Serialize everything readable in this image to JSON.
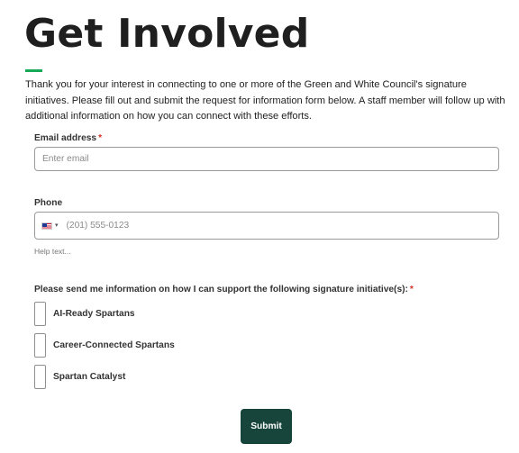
{
  "page": {
    "title": "Get Involved",
    "intro": "Thank you for your interest in connecting to one or more of the Green and White Council's signature initiatives. Please fill out and submit the request for information form below. A staff member will follow up with additional information on how you can connect with these efforts.",
    "accent_color": "#18a957"
  },
  "form": {
    "email": {
      "label": "Email address",
      "required_marker": "*",
      "placeholder": "Enter email",
      "value": ""
    },
    "phone": {
      "label": "Phone",
      "country_icon": "us-flag-icon",
      "placeholder": "(201) 555-0123",
      "value": "",
      "help_text": "Help text..."
    },
    "initiatives": {
      "label": "Please send me information on how I can support the following signature initiative(s):",
      "required_marker": "*",
      "options": [
        {
          "label": "AI-Ready Spartans",
          "checked": false
        },
        {
          "label": "Career-Connected Spartans",
          "checked": false
        },
        {
          "label": "Spartan Catalyst",
          "checked": false
        }
      ]
    },
    "submit_label": "Submit",
    "submit_color": "#18453b"
  }
}
